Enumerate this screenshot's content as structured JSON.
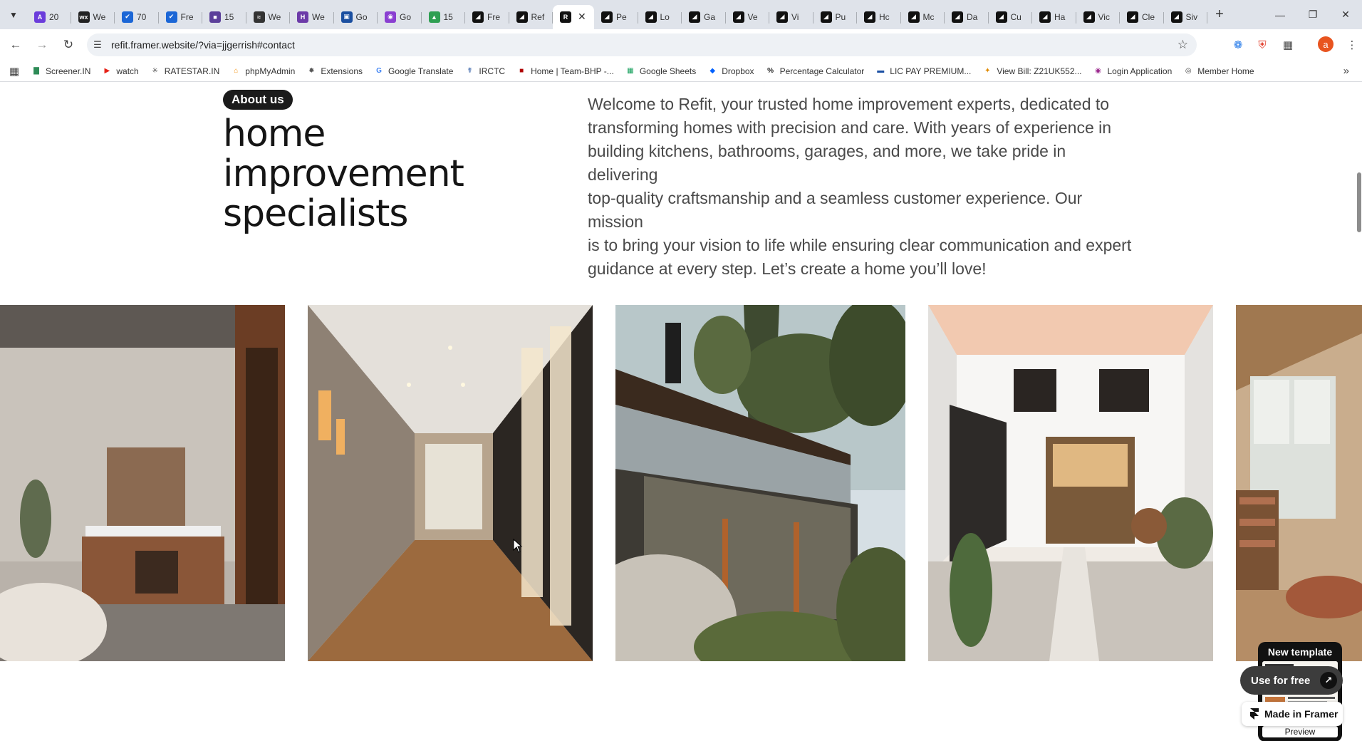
{
  "browser": {
    "tabs": [
      {
        "label": "20",
        "favicon_text": "A",
        "favicon_color": "#6b3ddb"
      },
      {
        "label": "We",
        "favicon_text": "wx",
        "favicon_color": "#222222"
      },
      {
        "label": "70",
        "favicon_text": "✔",
        "favicon_color": "#1b66d6"
      },
      {
        "label": "Fre",
        "favicon_text": "✔",
        "favicon_color": "#1b66d6"
      },
      {
        "label": "15",
        "favicon_text": "■",
        "favicon_color": "#5b3f9a"
      },
      {
        "label": "We",
        "favicon_text": "≈",
        "favicon_color": "#333333"
      },
      {
        "label": "We",
        "favicon_text": "H",
        "favicon_color": "#6c3aa8"
      },
      {
        "label": "Go",
        "favicon_text": "▣",
        "favicon_color": "#1b4fa0"
      },
      {
        "label": "Go",
        "favicon_text": "◉",
        "favicon_color": "#8a3fd1"
      },
      {
        "label": "15",
        "favicon_text": "▲",
        "favicon_color": "#2e9f52"
      },
      {
        "label": "Fre",
        "favicon_text": "◢",
        "favicon_color": "#111111"
      },
      {
        "label": "Ref",
        "favicon_text": "◢",
        "favicon_color": "#111111"
      },
      {
        "label": "",
        "favicon_text": "R",
        "favicon_color": "#111111",
        "active": true
      },
      {
        "label": "Pe",
        "favicon_text": "◢",
        "favicon_color": "#111111"
      },
      {
        "label": "Lo",
        "favicon_text": "◢",
        "favicon_color": "#111111"
      },
      {
        "label": "Ga",
        "favicon_text": "◢",
        "favicon_color": "#111111"
      },
      {
        "label": "Ve",
        "favicon_text": "◢",
        "favicon_color": "#111111"
      },
      {
        "label": "Vi",
        "favicon_text": "◢",
        "favicon_color": "#111111"
      },
      {
        "label": "Pu",
        "favicon_text": "◢",
        "favicon_color": "#111111"
      },
      {
        "label": "Hc",
        "favicon_text": "◢",
        "favicon_color": "#111111"
      },
      {
        "label": "Mc",
        "favicon_text": "◢",
        "favicon_color": "#111111"
      },
      {
        "label": "Da",
        "favicon_text": "◢",
        "favicon_color": "#111111"
      },
      {
        "label": "Cu",
        "favicon_text": "◢",
        "favicon_color": "#111111"
      },
      {
        "label": "Ha",
        "favicon_text": "◢",
        "favicon_color": "#111111"
      },
      {
        "label": "Vic",
        "favicon_text": "◢",
        "favicon_color": "#111111"
      },
      {
        "label": "Cle",
        "favicon_text": "◢",
        "favicon_color": "#111111"
      },
      {
        "label": "Siv",
        "favicon_text": "◢",
        "favicon_color": "#111111"
      }
    ],
    "active_tab_close": "✕",
    "new_tab": "+",
    "window_controls": {
      "minimize": "—",
      "restore": "❐",
      "close": "✕"
    },
    "nav": {
      "back": "←",
      "forward": "→",
      "reload": "↻"
    },
    "url": "refit.framer.website/?via=jjgerrish#contact",
    "profile_initial": "a",
    "bookmarks": [
      {
        "label": "Screener.IN",
        "icon_text": "▇",
        "icon_color": "#2e8b57"
      },
      {
        "label": "watch",
        "icon_text": "▶",
        "icon_color": "#e62117"
      },
      {
        "label": "RATESTAR.IN",
        "icon_text": "✳",
        "icon_color": "#555555"
      },
      {
        "label": "phpMyAdmin",
        "icon_text": "⌂",
        "icon_color": "#f29111"
      },
      {
        "label": "Extensions",
        "icon_text": "✸",
        "icon_color": "#555555"
      },
      {
        "label": "Google Translate",
        "icon_text": "G",
        "icon_color": "#4285f4"
      },
      {
        "label": "IRCTC",
        "icon_text": "☤",
        "icon_color": "#1d4e9e"
      },
      {
        "label": "Home | Team-BHP -...",
        "icon_text": "■",
        "icon_color": "#b00000"
      },
      {
        "label": "Google Sheets",
        "icon_text": "▦",
        "icon_color": "#0f9d58"
      },
      {
        "label": "Dropbox",
        "icon_text": "◆",
        "icon_color": "#0061fe"
      },
      {
        "label": "Percentage Calculator",
        "icon_text": "%",
        "icon_color": "#222222"
      },
      {
        "label": "LIC PAY PREMIUM...",
        "icon_text": "▬",
        "icon_color": "#1a4fa3"
      },
      {
        "label": "View Bill: Z21UK552...",
        "icon_text": "✦",
        "icon_color": "#e08a00"
      },
      {
        "label": "Login Application",
        "icon_text": "◉",
        "icon_color": "#9c2a8f"
      },
      {
        "label": "Member Home",
        "icon_text": "◎",
        "icon_color": "#444444"
      }
    ]
  },
  "page": {
    "badge": "About us",
    "headline_lines": [
      "home",
      "improvement",
      "specialists"
    ],
    "intro_lines": [
      "Welcome to Refit, your trusted home improvement experts, dedicated to",
      "transforming homes with precision and care. With years of experience in",
      "building kitchens, bathrooms, garages, and more, we take pride in delivering",
      "top-quality craftsmanship and a seamless customer experience. Our mission",
      "is to bring your vision to life while ensuring clear communication and expert",
      "guidance at every step. Let’s create a home you’ll love!"
    ],
    "gallery": [
      {
        "name": "bathroom-image"
      },
      {
        "name": "hallway-image"
      },
      {
        "name": "modern-house-image"
      },
      {
        "name": "courtyard-image"
      },
      {
        "name": "living-room-image"
      }
    ]
  },
  "framer": {
    "new_template_title": "New template",
    "preview_label": "Preview",
    "use_for_free": "Use for free",
    "made_in_framer": "Made in Framer"
  }
}
